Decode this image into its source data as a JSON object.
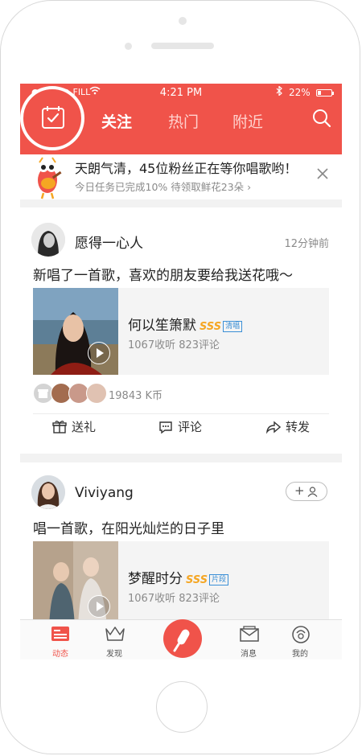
{
  "status_bar": {
    "carrier": "●●○○○ FILL",
    "time": "4:21 PM",
    "battery": "22%"
  },
  "header": {
    "tabs": [
      {
        "label": "关注"
      },
      {
        "label": "热门"
      },
      {
        "label": "附近"
      }
    ]
  },
  "banner": {
    "title": "天朗气清，45位粉丝正在等你唱歌哟！",
    "subtitle": "今日任务已完成10%  待领取鲜花23朵 ›"
  },
  "post1": {
    "username": "愿得一心人",
    "time": "12分钟前",
    "text": "新唱了一首歌，喜欢的朋友要给我送花哦～",
    "song": {
      "title": "何以笙箫默",
      "badge": "SSS",
      "tag": "清唱",
      "stats": "1067收听   823评论"
    },
    "gift_count": "19843 K币",
    "actions": {
      "gift": "送礼",
      "comment": "评论",
      "share": "转发"
    }
  },
  "post2": {
    "username": "Viviyang",
    "follow": "+",
    "text": "唱一首歌，在阳光灿烂的日子里",
    "song": {
      "title": "梦醒时分",
      "badge": "SSS",
      "tag": "片段",
      "stats": "1067收听   823评论"
    }
  },
  "tabbar": {
    "items": [
      {
        "label": "动态"
      },
      {
        "label": "发现"
      },
      {
        "label": "消息"
      },
      {
        "label": "我的"
      }
    ]
  },
  "colors": {
    "accent": "#f0534a",
    "badge": "#f5a623",
    "tag": "#3b8fd6"
  }
}
